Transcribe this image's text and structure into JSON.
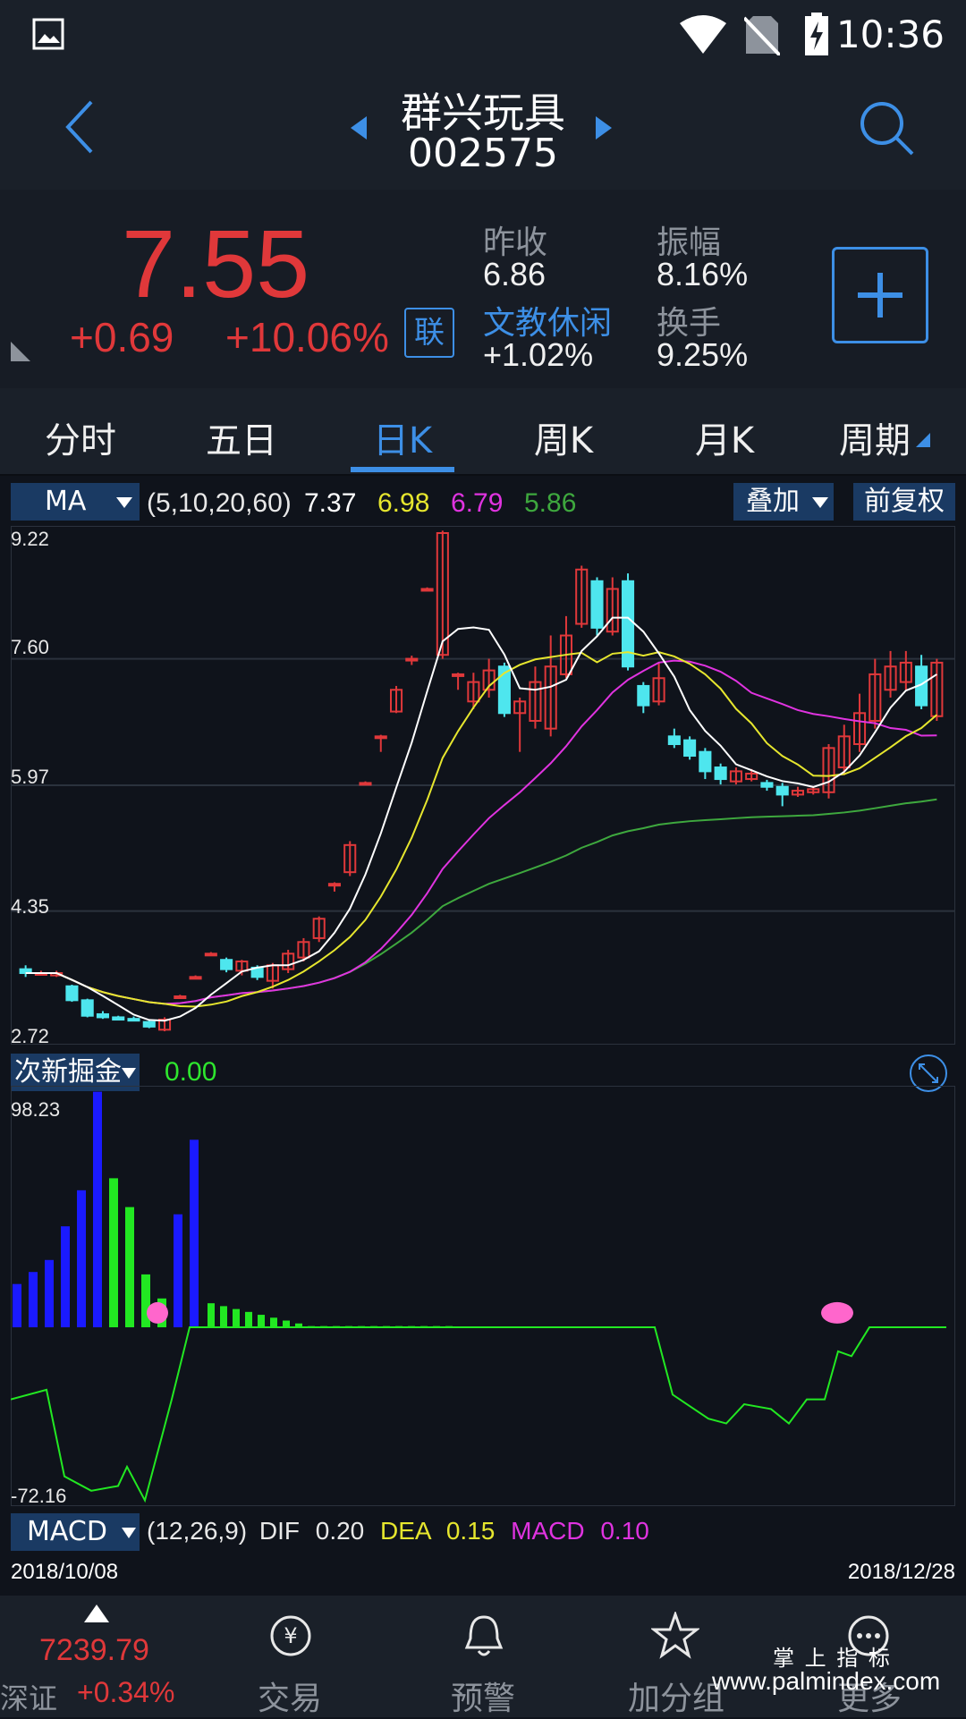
{
  "status_bar": {
    "time": "10:36",
    "icons": [
      "image-icon",
      "wifi-icon",
      "no-sim-icon",
      "battery-charging-icon"
    ]
  },
  "header": {
    "stock_name": "群兴玩具",
    "stock_code": "002575"
  },
  "quote": {
    "price": "7.55",
    "change": "+0.69",
    "change_pct": "+10.06%",
    "lian_badge": "联",
    "prev_close_label": "昨收",
    "prev_close": "6.86",
    "sector_label": "文教休闲",
    "sector_change": "+1.02%",
    "amplitude_label": "振幅",
    "amplitude": "8.16%",
    "turnover_label": "换手",
    "turnover": "9.25%"
  },
  "tabs": [
    {
      "label": "分时"
    },
    {
      "label": "五日"
    },
    {
      "label": "日K",
      "active": true
    },
    {
      "label": "周K"
    },
    {
      "label": "月K"
    },
    {
      "label": "周期"
    }
  ],
  "ma_bar": {
    "indicator": "MA",
    "params": "(5,10,20,60)",
    "ma5": "7.37",
    "ma10": "6.98",
    "ma20": "6.79",
    "ma60": "5.86",
    "overlay_label": "叠加",
    "adjust_label": "前复权"
  },
  "colors": {
    "up": "#e0383a",
    "down": "#4ee6ee",
    "ma5": "#ffffff",
    "ma10": "#e6e62e",
    "ma20": "#e033e0",
    "ma60": "#3ea83e",
    "accent": "#3d8fe6"
  },
  "price_axis": [
    "9.22",
    "7.60",
    "5.97",
    "4.35",
    "2.72"
  ],
  "sub_indicator": {
    "name": "次新掘金",
    "value": "0.00",
    "axis_top": "98.23",
    "axis_bottom": "-72.16"
  },
  "macd_bar": {
    "name": "MACD",
    "params": "(12,26,9)",
    "dif_label": "DIF",
    "dif": "0.20",
    "dea_label": "DEA",
    "dea": "0.15",
    "macd_label": "MACD",
    "macd": "0.10"
  },
  "date_range": {
    "start": "2018/10/08",
    "end": "2018/12/28"
  },
  "bottom_nav": {
    "index_value": "7239.79",
    "index_name": "深证",
    "index_change": "+0.34%",
    "items": [
      {
        "label": "交易"
      },
      {
        "label": "预警"
      },
      {
        "label": "加分组"
      },
      {
        "label": "更多"
      }
    ]
  },
  "watermark": {
    "line1": "掌 上 指 标",
    "line2": "www.palmindex.com"
  },
  "chart_data": {
    "type": "candlestick",
    "x_range": [
      "2018/10/08",
      "2018/12/28"
    ],
    "ylim": [
      2.72,
      9.22
    ],
    "candles": [
      [
        3.6,
        3.55,
        3.65,
        3.5
      ],
      [
        3.55,
        3.55,
        3.58,
        3.52
      ],
      [
        3.52,
        3.55,
        3.58,
        3.5
      ],
      [
        3.38,
        3.2,
        3.4,
        3.18
      ],
      [
        3.2,
        3.0,
        3.22,
        2.98
      ],
      [
        3.02,
        2.98,
        3.06,
        2.96
      ],
      [
        2.98,
        2.95,
        3.0,
        2.94
      ],
      [
        2.96,
        2.94,
        2.99,
        2.93
      ],
      [
        2.92,
        2.86,
        2.95,
        2.84
      ],
      [
        2.82,
        2.95,
        2.98,
        2.8
      ],
      [
        3.25,
        3.25,
        3.27,
        3.23
      ],
      [
        3.5,
        3.5,
        3.52,
        3.48
      ],
      [
        3.8,
        3.8,
        3.82,
        3.78
      ],
      [
        3.72,
        3.6,
        3.75,
        3.56
      ],
      [
        3.58,
        3.7,
        3.72,
        3.52
      ],
      [
        3.62,
        3.5,
        3.65,
        3.46
      ],
      [
        3.45,
        3.65,
        3.68,
        3.35
      ],
      [
        3.6,
        3.8,
        3.85,
        3.55
      ],
      [
        3.75,
        3.95,
        4.0,
        3.7
      ],
      [
        4.0,
        4.25,
        4.28,
        3.95
      ],
      [
        4.7,
        4.7,
        4.72,
        4.6
      ],
      [
        4.85,
        5.2,
        5.25,
        4.8
      ],
      [
        6.0,
        6.0,
        6.02,
        5.98
      ],
      [
        6.6,
        6.6,
        6.62,
        6.4
      ],
      [
        6.92,
        7.2,
        7.25,
        6.9
      ],
      [
        7.6,
        7.6,
        7.64,
        7.52
      ],
      [
        8.5,
        8.5,
        8.52,
        8.48
      ],
      [
        7.65,
        9.22,
        9.25,
        7.6
      ],
      [
        7.4,
        7.4,
        7.42,
        7.2
      ],
      [
        7.05,
        7.3,
        7.42,
        6.95
      ],
      [
        7.2,
        7.45,
        7.6,
        7.1
      ],
      [
        7.5,
        6.9,
        7.55,
        6.85
      ],
      [
        6.9,
        7.05,
        7.1,
        6.4
      ],
      [
        6.8,
        7.3,
        7.5,
        6.7
      ],
      [
        6.7,
        7.5,
        7.9,
        6.6
      ],
      [
        7.4,
        7.9,
        8.15,
        7.35
      ],
      [
        8.05,
        8.75,
        8.8,
        8.0
      ],
      [
        8.6,
        8.0,
        8.65,
        7.9
      ],
      [
        7.95,
        8.5,
        8.65,
        7.9
      ],
      [
        8.6,
        7.5,
        8.7,
        7.45
      ],
      [
        7.25,
        7.0,
        7.3,
        6.9
      ],
      [
        7.05,
        7.35,
        7.55,
        7.0
      ],
      [
        6.6,
        6.5,
        6.7,
        6.45
      ],
      [
        6.55,
        6.35,
        6.6,
        6.3
      ],
      [
        6.4,
        6.15,
        6.45,
        6.05
      ],
      [
        6.2,
        6.05,
        6.25,
        5.98
      ],
      [
        6.02,
        6.15,
        6.2,
        5.98
      ],
      [
        6.05,
        6.12,
        6.18,
        6.02
      ],
      [
        6.0,
        5.95,
        6.04,
        5.9
      ],
      [
        5.95,
        5.85,
        6.0,
        5.7
      ],
      [
        5.85,
        5.9,
        5.95,
        5.82
      ],
      [
        5.88,
        5.92,
        5.96,
        5.85
      ],
      [
        5.88,
        6.45,
        6.5,
        5.8
      ],
      [
        6.2,
        6.6,
        6.75,
        6.1
      ],
      [
        6.5,
        6.9,
        7.15,
        6.4
      ],
      [
        6.8,
        7.4,
        7.6,
        6.7
      ],
      [
        7.2,
        7.5,
        7.7,
        7.1
      ],
      [
        7.3,
        7.55,
        7.7,
        7.2
      ],
      [
        7.5,
        7.0,
        7.65,
        6.95
      ],
      [
        6.86,
        7.55,
        7.6,
        6.8
      ]
    ],
    "sub_bars_blue": [
      18,
      23,
      28,
      42,
      57,
      98,
      0,
      0,
      0,
      0,
      47,
      78
    ],
    "sub_bars_green": [
      0,
      0,
      0,
      0,
      0,
      0,
      62,
      50,
      22,
      12,
      0,
      0
    ]
  }
}
